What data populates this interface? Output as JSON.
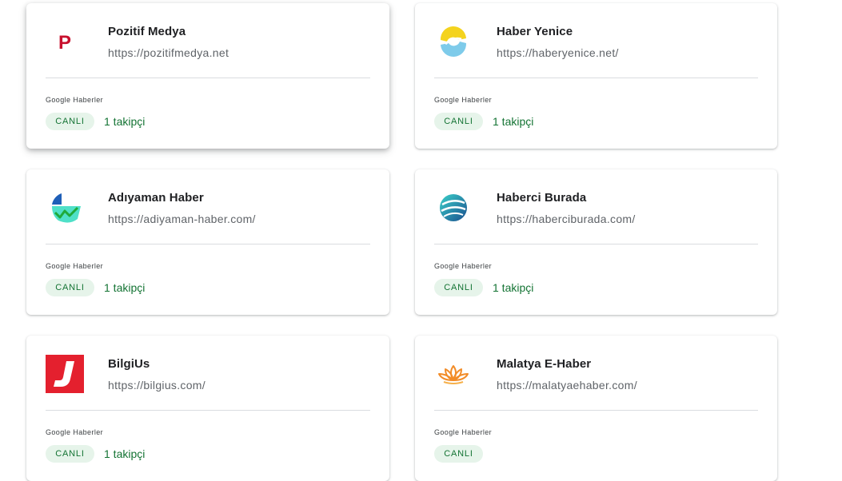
{
  "cards": [
    {
      "name": "Pozitif Medya",
      "url": "https://pozitifmedya.net",
      "source": "Google Haberler",
      "status": "CANLI",
      "followers": "1 takipçi",
      "logo": "pozitif-medya-logo-icon"
    },
    {
      "name": "Haber Yenice",
      "url": "https://haberyenice.net/",
      "source": "Google Haberler",
      "status": "CANLI",
      "followers": "1 takipçi",
      "logo": "haber-yenice-logo-icon"
    },
    {
      "name": "Adıyaman Haber",
      "url": "https://adiyaman-haber.com/",
      "source": "Google Haberler",
      "status": "CANLI",
      "followers": "1 takipçi",
      "logo": "adiyaman-haber-logo-icon"
    },
    {
      "name": "Haberci Burada",
      "url": "https://haberciburada.com/",
      "source": "Google Haberler",
      "status": "CANLI",
      "followers": "1 takipçi",
      "logo": "haberci-burada-logo-icon"
    },
    {
      "name": "BilgiUs",
      "url": "https://bilgius.com/",
      "source": "Google Haberler",
      "status": "CANLI",
      "followers": "1 takipçi",
      "logo": "bilgius-logo-icon"
    },
    {
      "name": "Malatya E-Haber",
      "url": "https://malatyaehaber.com/",
      "source": "Google Haberler",
      "status": "CANLI",
      "logo": "malatya-e-haber-logo-icon"
    }
  ],
  "colors": {
    "badge_bg": "#e6f4ea",
    "badge_text": "#137333",
    "divider": "#dadce0"
  }
}
